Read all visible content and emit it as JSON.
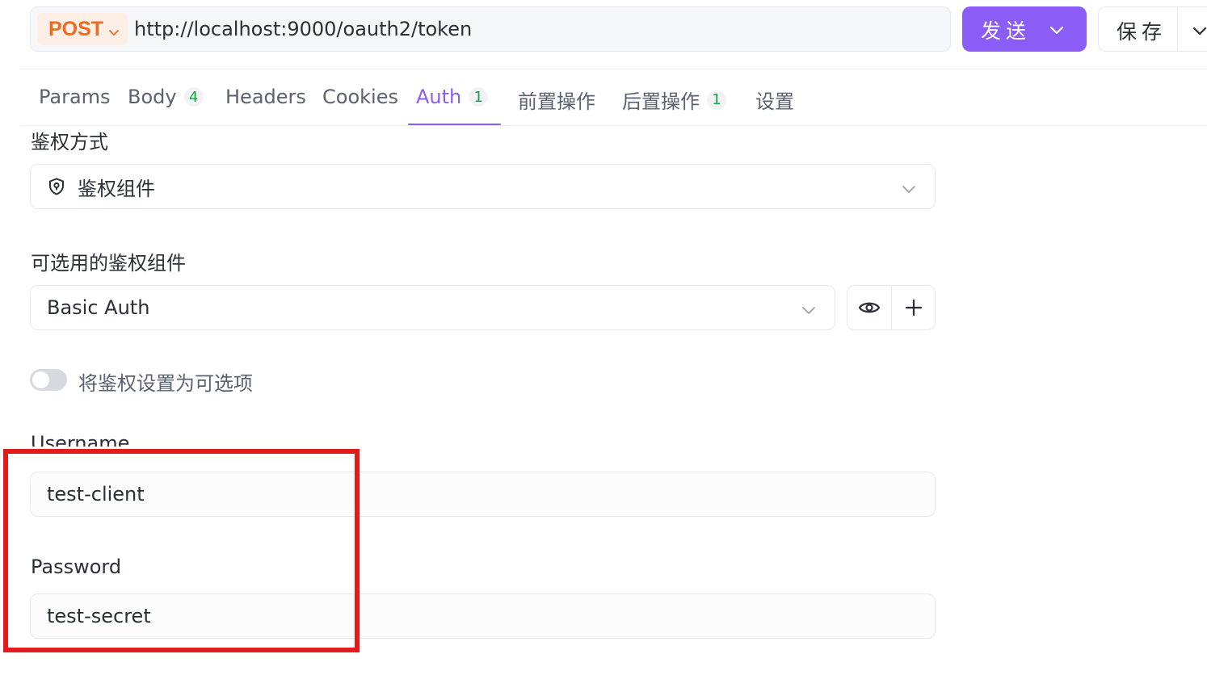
{
  "request": {
    "method": "POST",
    "url": "http://localhost:9000/oauth2/token",
    "send_label": "发送",
    "save_label": "保存"
  },
  "tabs": [
    {
      "label": "Params"
    },
    {
      "label": "Body",
      "badge": "4"
    },
    {
      "label": "Headers"
    },
    {
      "label": "Cookies"
    },
    {
      "label": "Auth",
      "badge": "1",
      "active": true
    },
    {
      "label": "前置操作"
    },
    {
      "label": "后置操作",
      "badge": "1"
    },
    {
      "label": "设置"
    }
  ],
  "auth": {
    "method_label": "鉴权方式",
    "method_value": "鉴权组件",
    "component_label": "可选用的鉴权组件",
    "component_value": "Basic Auth",
    "optional_toggle_label": "将鉴权设置为可选项",
    "optional_toggle_on": false,
    "username_label": "Username",
    "username_value": "test-client",
    "password_label": "Password",
    "password_value": "test-secret"
  },
  "colors": {
    "accent": "#8b5cf6",
    "method": "#f0691f",
    "badge": "#16a34a",
    "highlight": "#e21b1b"
  },
  "icons": [
    "chevron-down-icon",
    "shield-icon",
    "eye-icon",
    "plus-icon"
  ]
}
